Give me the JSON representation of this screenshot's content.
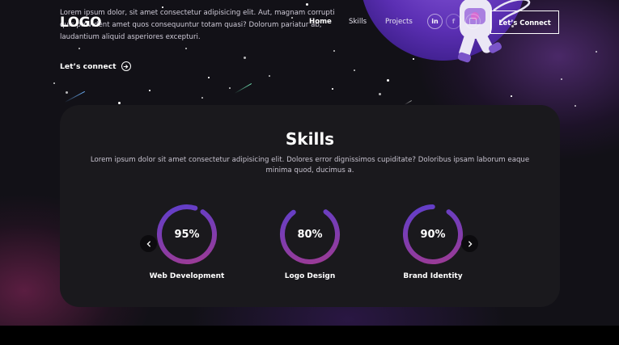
{
  "header": {
    "logo": "LOGO",
    "nav": {
      "home": "Home",
      "skills": "Skills",
      "projects": "Projects"
    },
    "social_icons": [
      "linkedin-icon",
      "facebook-icon",
      "instagram-icon"
    ],
    "connect_button": "Let’s Connect"
  },
  "hero": {
    "text": "Lorem ipsum dolor, sit amet consectetur adipisicing elit. Aut, magnam corrupti quis provident amet quos consequuntur totam quasi? Dolorum pariatur ab, laudantium aliquid asperiores excepturi.",
    "connect_link": "Let’s connect"
  },
  "skills": {
    "title": "Skills",
    "description": "Lorem ipsum dolor sit amet consectetur adipisicing elit. Dolores error dignissimos cupiditate? Doloribus ipsam laborum eaque minima quod, ducimus a.",
    "items": [
      {
        "label": "Web Development",
        "percent": 95,
        "display": "95%"
      },
      {
        "label": "Logo Design",
        "percent": 80,
        "display": "80%"
      },
      {
        "label": "Brand Identity",
        "percent": 90,
        "display": "90%"
      }
    ],
    "prev_icon": "chevron-left-icon",
    "next_icon": "chevron-right-icon"
  },
  "colors": {
    "ring_start": "#a23a8f",
    "ring_end": "#5a3fd0",
    "card": "#1a191d",
    "background": "#121117"
  }
}
